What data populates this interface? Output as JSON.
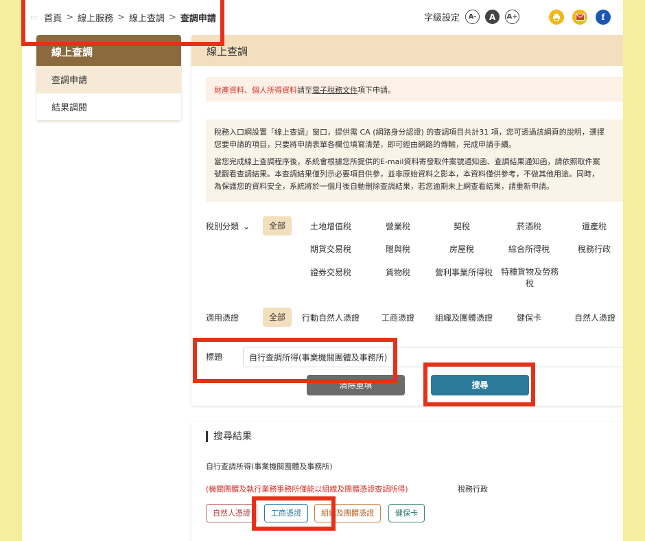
{
  "breadcrumb": {
    "home": "首頁",
    "online_services": "線上服務",
    "online_inquiry": "線上查調",
    "current": "查調申請"
  },
  "font_setting": {
    "label": "字級設定",
    "small": "A-",
    "medium": "A",
    "large": "A+"
  },
  "share": {
    "print_icon": "printer-icon",
    "mail_icon": "mail-icon",
    "facebook_icon": "facebook-icon",
    "facebook_letter": "f"
  },
  "sidebar": {
    "title": "線上查調",
    "items": [
      {
        "label": "查調申請"
      },
      {
        "label": "結果調閱"
      }
    ]
  },
  "main": {
    "title": "線上查調",
    "notice": {
      "part1": "財產資料",
      "sep": "、",
      "part2": "個人所得資料",
      "mid": "請至",
      "link": "電子稅務文件",
      "end": "項下申請。"
    },
    "intro": {
      "p1_l1": "稅務入口網設置「線上查調」窗口，提供需 CA (網路身分認證) 的查調項目共計31 項，您可透過該網頁的說明，選擇",
      "p1_l2": "您要申請的項目，只要將申請表單各欄位填寫清楚，即可經由網路的傳輸，完成申請手續。",
      "p2_l1": "當您完成線上查調程序後，系統會根據您所提供的E-mail資料寄發取件案號通知函、查調結果通知函，請依照取件案",
      "p2_l2": "號觀看查調結果。本查調結果僅列示必要項目供參，並非原始資料之影本，本資料僅供參考，不做其他用途。同時，",
      "p2_l3": "為保護您的資料安全，系統將於一個月後自動刪除查調結果，若您逾期未上網查看結果，請重新申請。"
    },
    "tax_filter": {
      "label": "稅別分類",
      "all": "全部",
      "items": [
        "土地增值稅",
        "營業稅",
        "契稅",
        "菸酒稅",
        "遺產稅",
        "期貨交易稅",
        "贈與稅",
        "房屋稅",
        "綜合所得稅",
        "稅務行政",
        "證券交易稅",
        "貨物稅",
        "營利事業所得稅",
        "特種貨物及勞務",
        "稅"
      ]
    },
    "cert_filter": {
      "label": "適用憑證",
      "all": "全部",
      "items": [
        "行動自然人憑證",
        "工商憑證",
        "組織及團體憑證",
        "健保卡",
        "自然人憑證"
      ]
    },
    "title_field": {
      "label": "標題",
      "value": "自行查調所得(事業機關團體及事務所)"
    },
    "clear_button": "清除重填",
    "search_button": "搜尋"
  },
  "results": {
    "heading": "搜尋結果",
    "item_name": "自行查調所得(事業機關團體及事務所)",
    "item_note": "(機關團體及執行業務事務所僅能以組織及團體憑證查調所得)",
    "item_category": "稅務行政",
    "tags": [
      "自然人憑證",
      "工商憑證",
      "組織及團體憑證",
      "健保卡"
    ]
  },
  "colors": {
    "background": "#f4ee9e",
    "sidebar_header": "#8a6a3e",
    "main_header": "#f3dfbe",
    "search_button": "#2b7a9c",
    "clear_button": "#6b6b6b",
    "highlight": "#e43219",
    "notice_red": "#d9312b"
  }
}
